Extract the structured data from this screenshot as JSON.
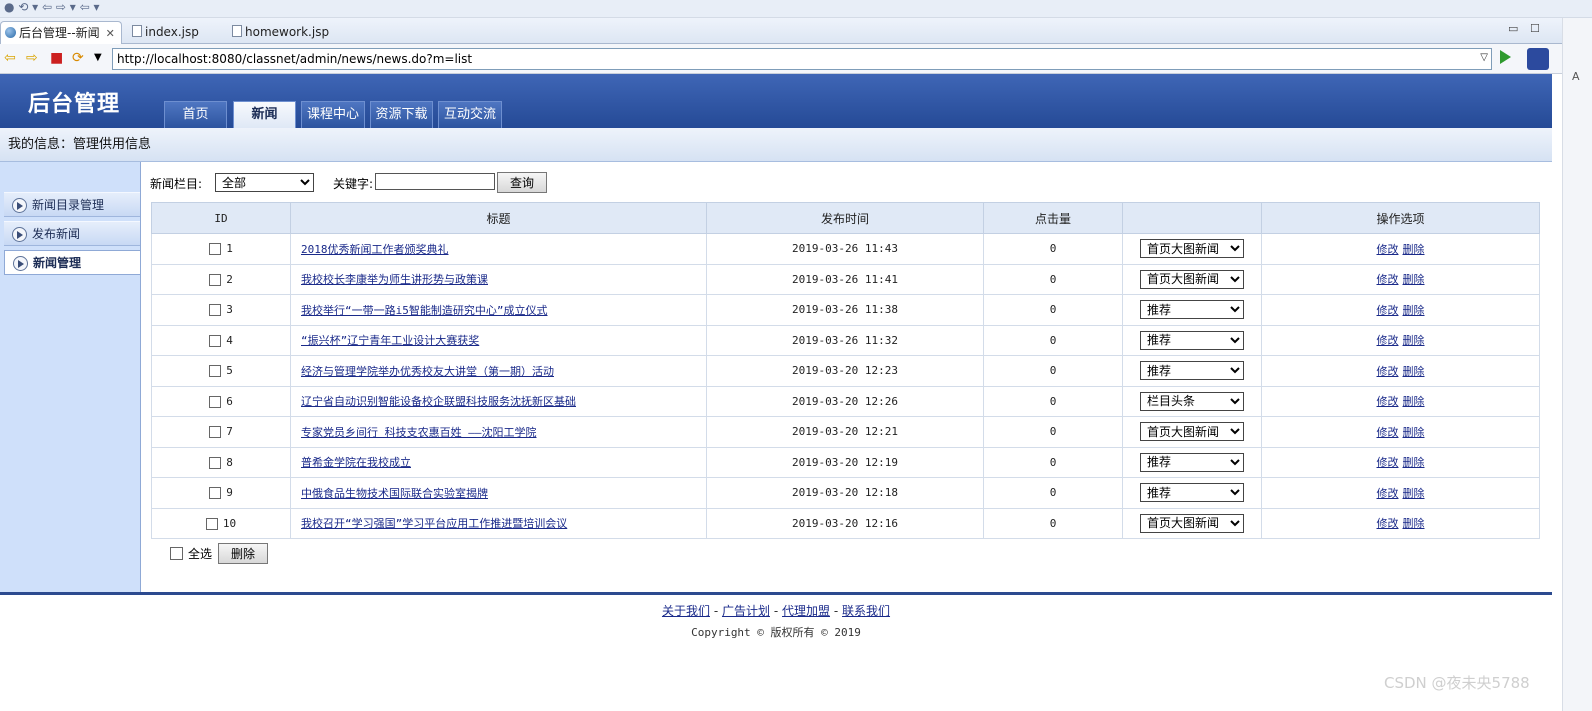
{
  "ide": {
    "tabs": [
      {
        "label": "后台管理--新闻",
        "active": true
      },
      {
        "label": "index.jsp",
        "active": false
      },
      {
        "label": "homework.jsp",
        "active": false
      }
    ],
    "close_glyph": "✕",
    "min_glyph": "▭",
    "max_glyph": "☐"
  },
  "browser": {
    "url": "http://localhost:8080/classnet/admin/news/news.do?m=list"
  },
  "header": {
    "logo": "后台管理",
    "menu": [
      "首页",
      "新闻",
      "课程中心",
      "资源下载",
      "互动交流"
    ],
    "active_menu_index": 1
  },
  "info_bar": "我的信息：管理供用信息",
  "sidebar": {
    "items": [
      "新闻目录管理",
      "发布新闻",
      "新闻管理"
    ],
    "active_index": 2
  },
  "search": {
    "category_label": "新闻栏目:",
    "category_value": "全部",
    "keyword_label": "关键字:",
    "keyword_value": "",
    "button": "查询"
  },
  "table": {
    "headers": [
      "ID",
      "标题",
      "发布时间",
      "点击量",
      "",
      "操作选项"
    ],
    "edit_label": "修改",
    "delete_label": "删除",
    "rows": [
      {
        "id": "1",
        "title": "2018优秀新闻工作者颁奖典礼",
        "time": "2019-03-26 11:43",
        "hits": "0",
        "type": "首页大图新闻"
      },
      {
        "id": "2",
        "title": "我校校长李康举为师生讲形势与政策课",
        "time": "2019-03-26 11:41",
        "hits": "0",
        "type": "首页大图新闻"
      },
      {
        "id": "3",
        "title": "我校举行“一带一路i5智能制造研究中心”成立仪式",
        "time": "2019-03-26 11:38",
        "hits": "0",
        "type": "推荐"
      },
      {
        "id": "4",
        "title": "“振兴杯”辽宁青年工业设计大赛获奖",
        "time": "2019-03-26 11:32",
        "hits": "0",
        "type": "推荐"
      },
      {
        "id": "5",
        "title": "经济与管理学院举办优秀校友大讲堂（第一期）活动",
        "time": "2019-03-20 12:23",
        "hits": "0",
        "type": "推荐"
      },
      {
        "id": "6",
        "title": "辽宁省自动识别智能设备校企联盟科技服务沈抚新区基础",
        "time": "2019-03-20 12:26",
        "hits": "0",
        "type": "栏目头条"
      },
      {
        "id": "7",
        "title": "专家党员乡间行 科技支农惠百姓 ——沈阳工学院",
        "time": "2019-03-20 12:21",
        "hits": "0",
        "type": "首页大图新闻"
      },
      {
        "id": "8",
        "title": "普希金学院在我校成立",
        "time": "2019-03-20 12:19",
        "hits": "0",
        "type": "推荐"
      },
      {
        "id": "9",
        "title": "中俄食品生物技术国际联合实验室揭牌",
        "time": "2019-03-20 12:18",
        "hits": "0",
        "type": "推荐"
      },
      {
        "id": "10",
        "title": "我校召开“学习强国”学习平台应用工作推进暨培训会议",
        "time": "2019-03-20 12:16",
        "hits": "0",
        "type": "首页大图新闻"
      }
    ]
  },
  "bulk": {
    "select_all": "全选",
    "delete_button": "删除"
  },
  "footer": {
    "links": [
      "关于我们",
      "广告计划",
      "代理加盟",
      "联系我们"
    ],
    "separator": "-",
    "copyright": "Copyright © 版权所有 © 2019"
  },
  "watermark": "CSDN @夜未央5788"
}
